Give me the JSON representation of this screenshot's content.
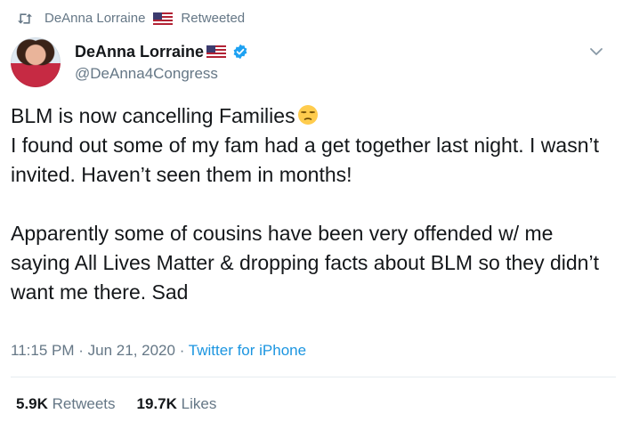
{
  "retweet": {
    "retweeter": "DeAnna Lorraine",
    "label": "Retweeted"
  },
  "author": {
    "name": "DeAnna Lorraine",
    "handle": "@DeAnna4Congress"
  },
  "tweet": {
    "line1": "BLM is now cancelling Families",
    "para1_rest": "I found out some of my fam had a get together last night. I wasn’t invited. Haven’t seen them in months!",
    "para2": "Apparently some of cousins have been very offended w/ me saying All Lives Matter & dropping facts about BLM so they didn’t want me there. Sad"
  },
  "meta": {
    "time": "11:15 PM",
    "sep1": "·",
    "date": "Jun 21, 2020",
    "sep2": "·",
    "source": "Twitter for iPhone"
  },
  "stats": {
    "retweets_count": "5.9K",
    "retweets_label": "Retweets",
    "likes_count": "19.7K",
    "likes_label": "Likes"
  },
  "colors": {
    "secondary_text": "#657786",
    "link": "#1b95e0",
    "verified": "#1da1f2"
  },
  "icons": [
    "retweet-icon",
    "us-flag-icon",
    "verified-badge-icon",
    "chevron-down-icon",
    "unamused-face-emoji"
  ]
}
